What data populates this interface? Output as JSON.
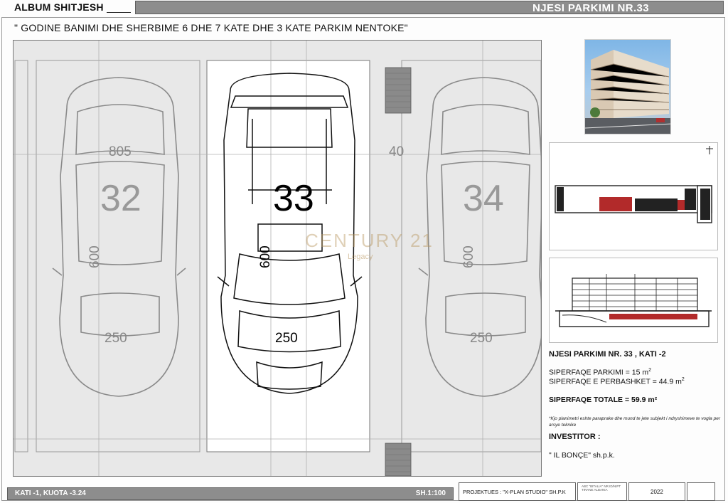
{
  "header": {
    "album_title": "ALBUM SHITJESH",
    "unit_title": "NJESI PARKIMI NR.33",
    "subtitle": "\" GODINE BANIMI DHE SHERBIME 6 DHE 7 KATE DHE 3 KATE PARKIM NENTOKE\""
  },
  "plan": {
    "spaces": [
      {
        "number": "32",
        "width_dim": "250",
        "length_dim": "600",
        "highlighted": false
      },
      {
        "number": "33",
        "width_dim": "250",
        "length_dim": "600",
        "highlighted": true
      },
      {
        "number": "34",
        "width_dim": "250",
        "length_dim": "600",
        "highlighted": false
      }
    ],
    "dim_top_left": "805",
    "dim_gap": "40",
    "watermark": "CENTURY 21",
    "watermark_sub": "Legacy"
  },
  "info": {
    "title": "NJESI PARKIMI NR. 33 , KATI -2",
    "parking_area": "SIPERFAQE PARKIMI = 15 m",
    "shared_area": "SIPERFAQE E PERBASHKET = 44.9 m",
    "area_unit_sup": "2",
    "total_area": "SIPERFAQE TOTALE = 59.9 m²",
    "note": "*Kjo planimetri eshte paraprake dhe mund te jete subjekt i ndryshimeve te vogla per arsye teknike",
    "investor_label": "INVESTITOR :",
    "investor_name": "\" IL BONÇE\" sh.p.k."
  },
  "footer": {
    "floor_label": "KATI -1, KUOTA -3.24",
    "scale": "SH.1:100",
    "designer": "PROJEKTUES : \"X-PLAN STUDIO\" SH.P.K",
    "logo_text": "ABC \"BITALIA\" NR.ID/NIPT TIRANE ALBANIA",
    "year": "2022"
  },
  "colors": {
    "banner": "#8d8d8d",
    "plan_bg": "#e8e8e8",
    "highlight_bg": "#ffffff",
    "section_red": "#b22a2a"
  }
}
